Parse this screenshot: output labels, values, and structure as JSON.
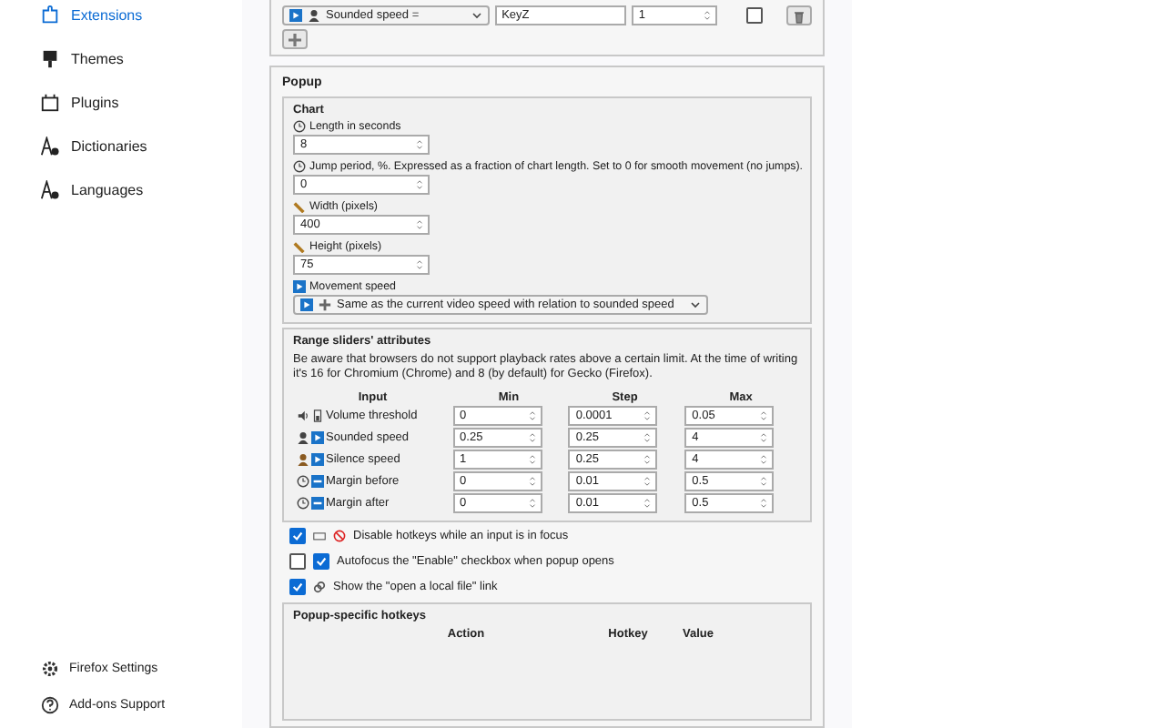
{
  "sidebar": {
    "items": [
      {
        "label": "Extensions",
        "selected": true
      },
      {
        "label": "Themes",
        "selected": false
      },
      {
        "label": "Plugins",
        "selected": false
      },
      {
        "label": "Dictionaries",
        "selected": false
      },
      {
        "label": "Languages",
        "selected": false
      }
    ],
    "footer": [
      "Firefox Settings",
      "Add-ons Support"
    ]
  },
  "hotkey_row": {
    "action": "Sounded speed =",
    "key": "KeyZ",
    "value": "1",
    "checked": false
  },
  "popup": {
    "title": "Popup",
    "chart": {
      "title": "Chart",
      "fields": [
        {
          "label": "Length in seconds",
          "value": "8"
        },
        {
          "label": "Jump period, %. Expressed as a fraction of chart length. Set to 0 for smooth movement (no jumps).",
          "value": "0"
        },
        {
          "label": "Width (pixels)",
          "value": "400"
        },
        {
          "label": "Height (pixels)",
          "value": "75"
        }
      ],
      "movement": {
        "label": "Movement speed",
        "value": "Same as the current video speed with relation to sounded speed"
      }
    },
    "range": {
      "title": "Range sliders' attributes",
      "note": "Be aware that browsers do not support playback rates above a certain limit. At the time of writing it's 16 for Chromium (Chrome) and 8 (by default) for Gecko (Firefox).",
      "columns": [
        "Input",
        "Min",
        "Step",
        "Max"
      ],
      "rows": [
        {
          "label": "Volume threshold",
          "min": "0",
          "step": "0.0001",
          "max": "0.05"
        },
        {
          "label": "Sounded speed",
          "min": "0.25",
          "step": "0.25",
          "max": "4"
        },
        {
          "label": "Silence speed",
          "min": "1",
          "step": "0.25",
          "max": "4"
        },
        {
          "label": "Margin before",
          "min": "0",
          "step": "0.01",
          "max": "0.5"
        },
        {
          "label": "Margin after",
          "min": "0",
          "step": "0.01",
          "max": "0.5"
        }
      ]
    },
    "options": [
      {
        "label": "Disable hotkeys while an input is in focus",
        "checked": true
      },
      {
        "label": "Autofocus the \"Enable\" checkbox when popup opens",
        "checked": false
      },
      {
        "label": "Show the \"open a local file\" link",
        "checked": true
      }
    ],
    "hotkeys": {
      "title": "Popup-specific hotkeys",
      "columns": [
        "Action",
        "Hotkey",
        "Value"
      ]
    }
  }
}
